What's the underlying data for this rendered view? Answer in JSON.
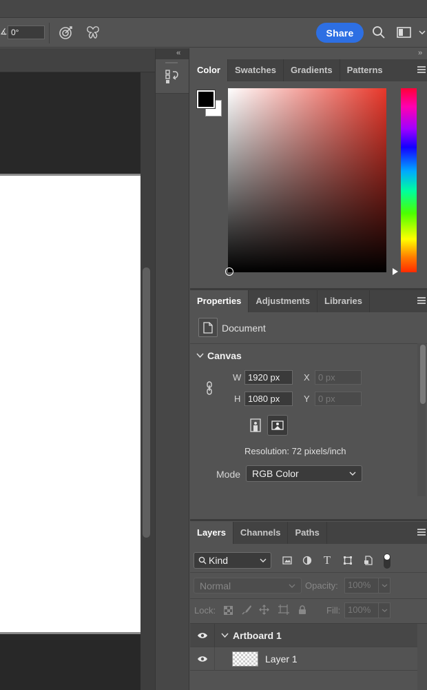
{
  "toolbar": {
    "angle_value": "0°",
    "share_label": "Share",
    "icons": [
      "angle-icon",
      "target-icon",
      "butterfly-icon",
      "search-icon",
      "workspace-icon",
      "chevron-down-icon"
    ]
  },
  "dock": {
    "collapse_left": "‹‹",
    "collapse_right": "››"
  },
  "color_panel": {
    "tabs": [
      "Color",
      "Swatches",
      "Gradients",
      "Patterns"
    ],
    "foreground": "#000000",
    "background": "#ffffff",
    "hue_color": "#e8372a"
  },
  "properties_panel": {
    "tabs": [
      "Properties",
      "Adjustments",
      "Libraries"
    ],
    "doc_label": "Document",
    "section_title": "Canvas",
    "w_label": "W",
    "w_value": "1920 px",
    "h_label": "H",
    "h_value": "1080 px",
    "x_label": "X",
    "x_value": "0 px",
    "y_label": "Y",
    "y_value": "0 px",
    "resolution": "Resolution: 72 pixels/inch",
    "mode_label": "Mode",
    "mode_value": "RGB Color"
  },
  "layers_panel": {
    "tabs": [
      "Layers",
      "Channels",
      "Paths"
    ],
    "filter_value": "Kind",
    "blend_mode": "Normal",
    "opacity_label": "Opacity:",
    "opacity_value": "100%",
    "lock_label": "Lock:",
    "fill_label": "Fill:",
    "fill_value": "100%",
    "layers": [
      {
        "name": "Artboard 1",
        "type": "artboard"
      },
      {
        "name": "Layer 1",
        "type": "layer"
      }
    ]
  }
}
